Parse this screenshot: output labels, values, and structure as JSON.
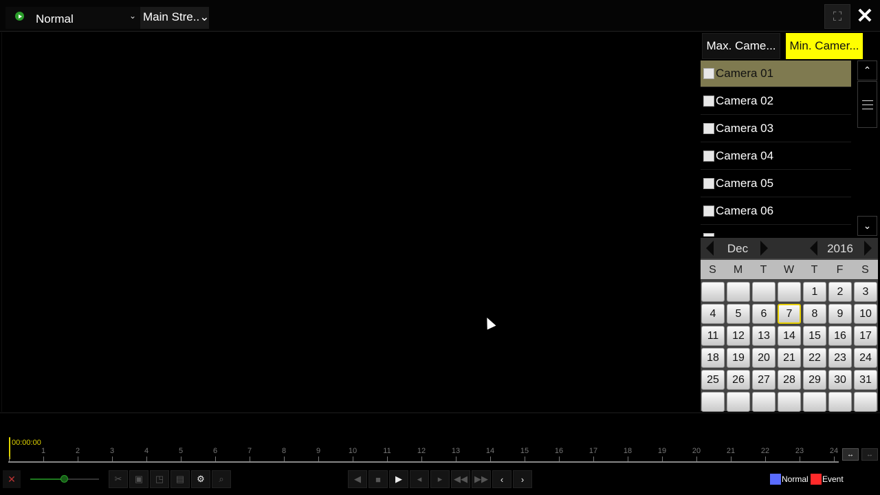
{
  "topbar": {
    "mode": {
      "label": "Normal",
      "icon": "play-circle-icon",
      "caret": "⌄"
    },
    "stream": {
      "label": "Main Stre..⌄"
    },
    "fullscreen_icon": "fullscreen-icon",
    "close_icon": "✕"
  },
  "panel": {
    "tab_max": "Max. Came...",
    "tab_min": "Min. Camer...",
    "tab_min_color": "#ffff00",
    "cameras": [
      "Camera 01",
      "Camera 02",
      "Camera 03",
      "Camera 04",
      "Camera 05",
      "Camera 06"
    ],
    "selected_camera": "Camera 01",
    "scroll_up": "⌃",
    "scroll_down": "⌄"
  },
  "calendar": {
    "month": "Dec",
    "year": "2016",
    "weekdays": [
      "S",
      "M",
      "T",
      "W",
      "T",
      "F",
      "S"
    ],
    "days": [
      "1",
      "2",
      "3",
      "4",
      "5",
      "6",
      "7",
      "8",
      "9",
      "10",
      "11",
      "12",
      "13",
      "14",
      "15",
      "16",
      "17",
      "18",
      "19",
      "20",
      "21",
      "22",
      "23",
      "24",
      "25",
      "26",
      "27",
      "28",
      "29",
      "30",
      "31"
    ],
    "first_weekday_index": 4,
    "today": "7"
  },
  "timeline": {
    "current_time": "00:00:00",
    "hour_labels": [
      "1",
      "2",
      "3",
      "4",
      "5",
      "6",
      "7",
      "8",
      "9",
      "10",
      "11",
      "12",
      "13",
      "14",
      "15",
      "16",
      "17",
      "18",
      "19",
      "20",
      "21",
      "22",
      "23",
      "24"
    ],
    "zoom_in": "↔",
    "zoom_out": "↔"
  },
  "toolbar": {
    "mute_icon": "🔇",
    "volume_level": 0.5,
    "settings_icon": "⚙",
    "search_icon": "search-icon",
    "play": "▶",
    "stop": "■",
    "prev": "‹",
    "next": "›"
  },
  "legend": {
    "normal": "Normal",
    "event": "Event",
    "normal_color": "#5a6cff",
    "event_color": "#ff2a2a"
  }
}
